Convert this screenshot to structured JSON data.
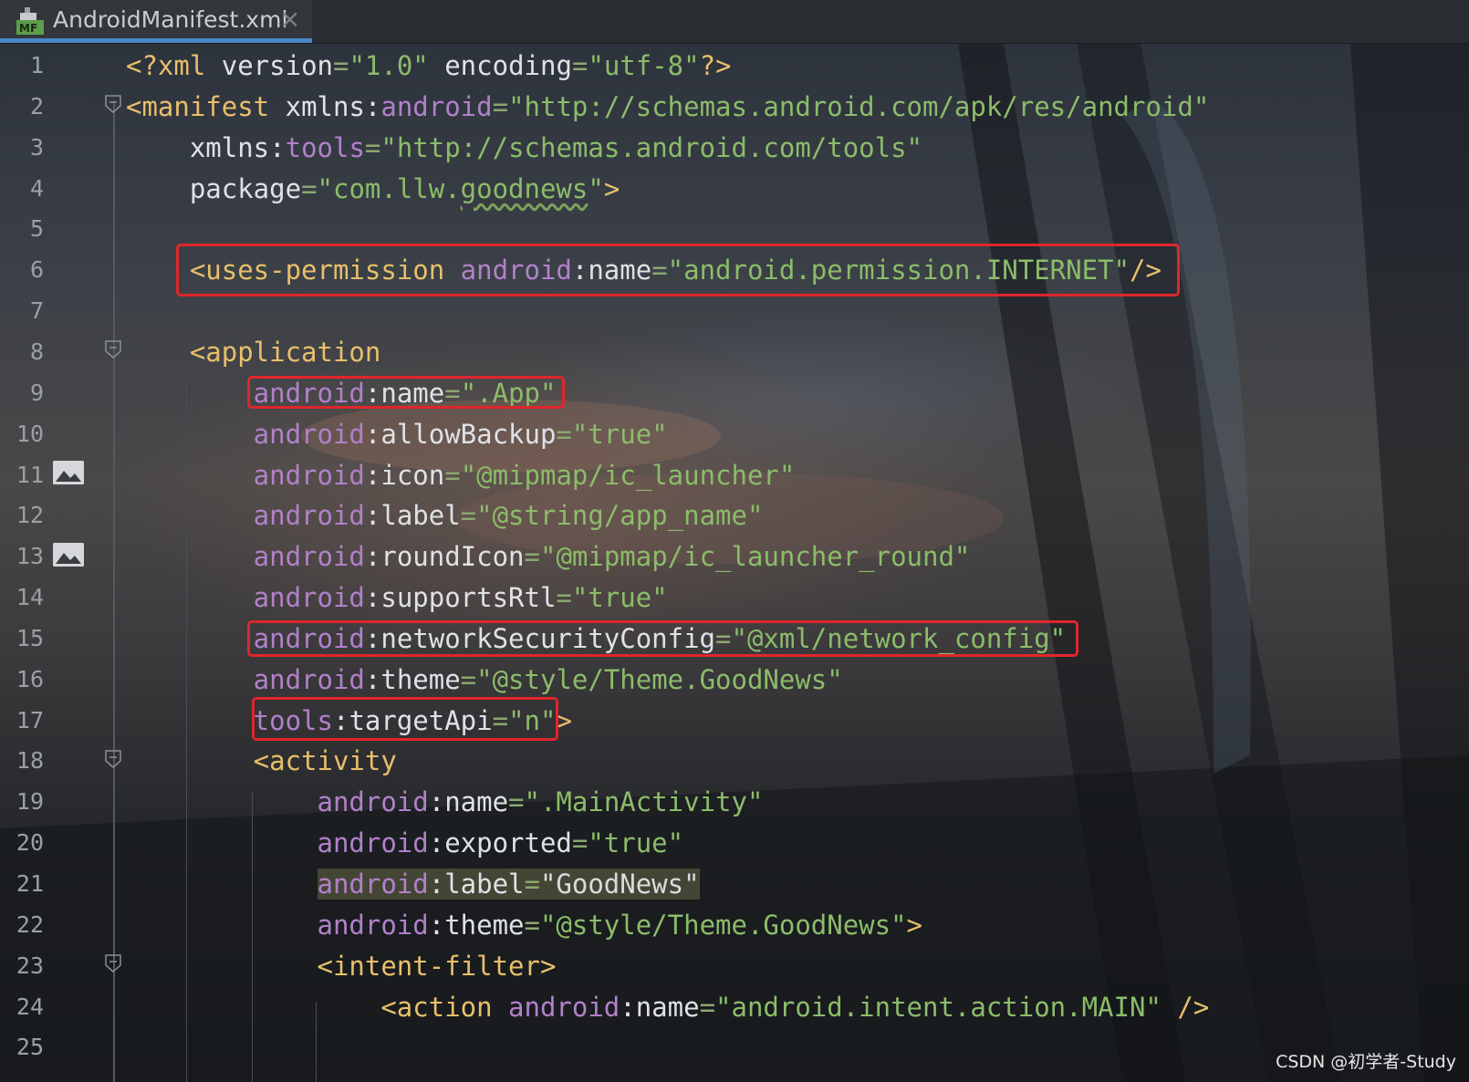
{
  "tab": {
    "title": "AndroidManifest.xml",
    "icon": "manifest-file-icon",
    "icon_badge": "MF",
    "close_glyph": "×"
  },
  "editor": {
    "lines": [
      {
        "n": "1",
        "segments": [
          [
            "pi",
            "<?xml "
          ],
          [
            "attr",
            "version"
          ],
          [
            "eq",
            "="
          ],
          [
            "val",
            "\"1.0\""
          ],
          [
            "attr",
            " encoding"
          ],
          [
            "eq",
            "="
          ],
          [
            "val",
            "\"utf-8\""
          ],
          [
            "pi",
            "?>"
          ]
        ]
      },
      {
        "n": "2",
        "segments": [
          [
            "tag",
            "<manifest "
          ],
          [
            "attr",
            "xmlns:"
          ],
          [
            "ns",
            "android"
          ],
          [
            "eq",
            "="
          ],
          [
            "val",
            "\"http://schemas.android.com/apk/res/android\""
          ]
        ]
      },
      {
        "n": "3",
        "segments": [
          [
            "attr",
            "    xmlns:"
          ],
          [
            "ns",
            "tools"
          ],
          [
            "eq",
            "="
          ],
          [
            "val",
            "\"http://schemas.android.com/tools\""
          ]
        ]
      },
      {
        "n": "4",
        "segments": [
          [
            "attr",
            "    package"
          ],
          [
            "eq",
            "="
          ],
          [
            "val",
            "\"com.llw."
          ],
          [
            "val-squiggle",
            "goodnews"
          ],
          [
            "val",
            "\""
          ],
          [
            "tag",
            ">"
          ]
        ]
      },
      {
        "n": "5",
        "segments": []
      },
      {
        "n": "6",
        "segments": [
          [
            "tag",
            "    <uses-permission "
          ],
          [
            "ns",
            "android"
          ],
          [
            "attr",
            ":name"
          ],
          [
            "eq",
            "="
          ],
          [
            "val",
            "\"android.permission.INTERNET\""
          ],
          [
            "tag",
            "/>"
          ]
        ]
      },
      {
        "n": "7",
        "segments": []
      },
      {
        "n": "8",
        "segments": [
          [
            "tag",
            "    <application"
          ]
        ]
      },
      {
        "n": "9",
        "segments": [
          [
            "ns",
            "        android"
          ],
          [
            "attr",
            ":name"
          ],
          [
            "eq",
            "="
          ],
          [
            "val",
            "\".App\""
          ]
        ]
      },
      {
        "n": "10",
        "segments": [
          [
            "ns",
            "        android"
          ],
          [
            "attr",
            ":allowBackup"
          ],
          [
            "eq",
            "="
          ],
          [
            "val",
            "\"true\""
          ]
        ]
      },
      {
        "n": "11",
        "segments": [
          [
            "ns",
            "        android"
          ],
          [
            "attr",
            ":icon"
          ],
          [
            "eq",
            "="
          ],
          [
            "val",
            "\"@mipmap/ic_launcher\""
          ]
        ]
      },
      {
        "n": "12",
        "segments": [
          [
            "ns",
            "        android"
          ],
          [
            "attr",
            ":label"
          ],
          [
            "eq",
            "="
          ],
          [
            "val",
            "\"@string/app_name\""
          ]
        ]
      },
      {
        "n": "13",
        "segments": [
          [
            "ns",
            "        android"
          ],
          [
            "attr",
            ":roundIcon"
          ],
          [
            "eq",
            "="
          ],
          [
            "val",
            "\"@mipmap/ic_launcher_round\""
          ]
        ]
      },
      {
        "n": "14",
        "segments": [
          [
            "ns",
            "        android"
          ],
          [
            "attr",
            ":supportsRtl"
          ],
          [
            "eq",
            "="
          ],
          [
            "val",
            "\"true\""
          ]
        ]
      },
      {
        "n": "15",
        "segments": [
          [
            "ns",
            "        android"
          ],
          [
            "attr",
            ":networkSecurityConfig"
          ],
          [
            "eq",
            "="
          ],
          [
            "val",
            "\"@xml/network_config\""
          ]
        ]
      },
      {
        "n": "16",
        "segments": [
          [
            "ns",
            "        android"
          ],
          [
            "attr",
            ":theme"
          ],
          [
            "eq",
            "="
          ],
          [
            "val",
            "\"@style/Theme.GoodNews\""
          ]
        ]
      },
      {
        "n": "17",
        "segments": [
          [
            "ns",
            "        tools"
          ],
          [
            "attr",
            ":targetApi"
          ],
          [
            "eq",
            "="
          ],
          [
            "val",
            "\"n\""
          ],
          [
            "tag",
            ">"
          ]
        ]
      },
      {
        "n": "18",
        "segments": [
          [
            "tag",
            "        <activity"
          ]
        ]
      },
      {
        "n": "19",
        "segments": [
          [
            "ns",
            "            android"
          ],
          [
            "attr",
            ":name"
          ],
          [
            "eq",
            "="
          ],
          [
            "val",
            "\".MainActivity\""
          ]
        ]
      },
      {
        "n": "20",
        "segments": [
          [
            "ns",
            "            android"
          ],
          [
            "attr",
            ":exported"
          ],
          [
            "eq",
            "="
          ],
          [
            "val",
            "\"true\""
          ]
        ]
      },
      {
        "n": "21",
        "segments": [
          [
            "sp",
            "            "
          ],
          [
            "ns-hl",
            "android"
          ],
          [
            "attr-hl",
            ":label"
          ],
          [
            "eq-hl",
            "="
          ],
          [
            "dim-hl",
            "\"GoodNews\""
          ]
        ]
      },
      {
        "n": "22",
        "segments": [
          [
            "ns",
            "            android"
          ],
          [
            "attr",
            ":theme"
          ],
          [
            "eq",
            "="
          ],
          [
            "val",
            "\"@style/Theme.GoodNews\""
          ],
          [
            "tag",
            ">"
          ]
        ]
      },
      {
        "n": "23",
        "segments": [
          [
            "tag",
            "            <intent-filter>"
          ]
        ]
      },
      {
        "n": "24",
        "segments": [
          [
            "tag",
            "                <action "
          ],
          [
            "ns",
            "android"
          ],
          [
            "attr",
            ":name"
          ],
          [
            "eq",
            "="
          ],
          [
            "val",
            "\"android.intent.action.MAIN\""
          ],
          [
            "tag",
            " />"
          ]
        ]
      },
      {
        "n": "25",
        "segments": []
      }
    ],
    "fold_markers": [
      "fold-icon",
      "fold-icon",
      "fold-icon",
      "fold-icon"
    ],
    "gutter_icons": [
      "image-preview-icon",
      "image-preview-icon"
    ],
    "colors": {
      "tag": "#e8bf6a",
      "namespace": "#b181ca",
      "attribute": "#dfe2e5",
      "value": "#8cbc6a",
      "highlight_box": "#e0262b",
      "tab_underline": "#4a88c7"
    }
  },
  "watermark": "CSDN @初学者-Study"
}
